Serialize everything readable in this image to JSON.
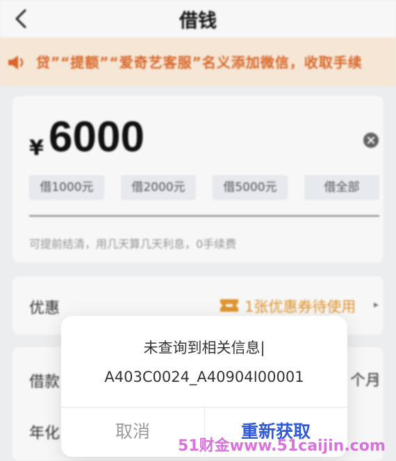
{
  "header": {
    "title": "借钱"
  },
  "notice": {
    "text": "贷”“提额”“爱奇艺客服”名义添加微信，收取手续"
  },
  "amount": {
    "currency": "¥",
    "value": "6000",
    "quick_options": [
      "借1000元",
      "借2000元",
      "借5000元",
      "借全部"
    ],
    "hint": "可提前结清，用几天算几天利息，0手续费"
  },
  "promo": {
    "label": "优惠",
    "value": "1张优惠券待使用"
  },
  "loan": {
    "term_label": "借款",
    "term_value": "个月",
    "rate_label": "年化"
  },
  "dialog": {
    "message": "未查询到相关信息|",
    "code": "A403C0024_A40904I00001",
    "cancel_label": "取消",
    "retry_label": "重新获取"
  },
  "watermark": "51财金www.51caijin.com",
  "colors": {
    "accent_orange": "#e06a2a",
    "coupon": "#e79a2f",
    "primary_blue": "#2f5bd9"
  }
}
